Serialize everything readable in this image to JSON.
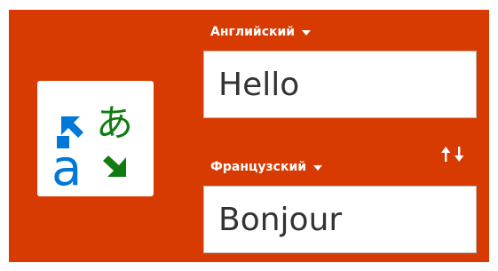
{
  "source": {
    "language": "Английский",
    "text": "Hello"
  },
  "target": {
    "language": "Французский",
    "text": "Bonjour"
  },
  "logo": {
    "icon": "translator-logo-icon",
    "glyph_latin": "a",
    "glyph_japanese": "あ"
  },
  "icons": {
    "swap": "swap-arrows-icon",
    "dropdown": "chevron-down-icon"
  },
  "colors": {
    "panel_background": "#d83b01",
    "logo_blue": "#0078d7",
    "logo_green": "#107c10",
    "text_box_background": "#ffffff"
  }
}
